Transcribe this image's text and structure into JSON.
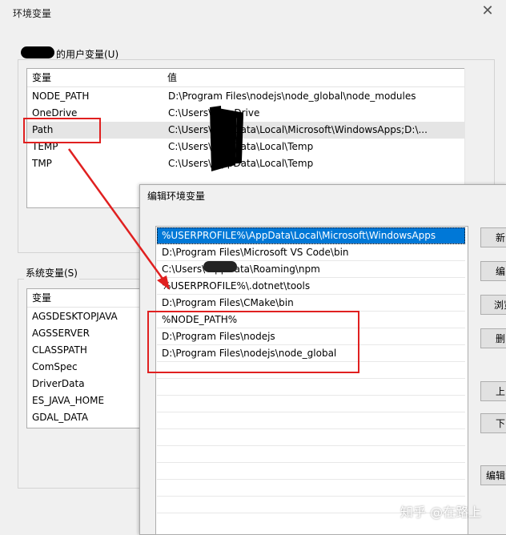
{
  "window": {
    "title": "环境变量",
    "close_glyph": "✕"
  },
  "user_vars": {
    "legend": "的用户变量(U)",
    "headers": [
      "变量",
      "值"
    ],
    "rows": [
      {
        "name": "NODE_PATH",
        "value": "D:\\Program Files\\nodejs\\node_global\\node_modules"
      },
      {
        "name": "OneDrive",
        "value": "C:\\Users\\          OneDrive"
      },
      {
        "name": "Path",
        "value": "C:\\Users\\          AppData\\Local\\Microsoft\\WindowsApps;D:\\..."
      },
      {
        "name": "TEMP",
        "value": "C:\\Users\\          AppData\\Local\\Temp"
      },
      {
        "name": "TMP",
        "value": "C:\\Users\\          AppData\\Local\\Temp"
      }
    ]
  },
  "system_vars": {
    "legend": "系统变量(S)",
    "header": "变量",
    "rows": [
      "AGSDESKTOPJAVA",
      "AGSSERVER",
      "CLASSPATH",
      "ComSpec",
      "DriverData",
      "ES_JAVA_HOME",
      "GDAL_DATA"
    ]
  },
  "edit_dialog": {
    "title": "编辑环境变量",
    "entries": [
      "%USERPROFILE%\\AppData\\Local\\Microsoft\\WindowsApps",
      "D:\\Program Files\\Microsoft VS Code\\bin",
      "C:\\Users\\          AppData\\Roaming\\npm",
      "%USERPROFILE%\\.dotnet\\tools",
      "D:\\Program Files\\CMake\\bin",
      "%NODE_PATH%",
      "D:\\Program Files\\nodejs",
      "D:\\Program Files\\nodejs\\node_global"
    ],
    "selected_index": 0,
    "buttons": [
      "新",
      "编",
      "浏览",
      "删",
      "上",
      "下",
      "编辑"
    ]
  },
  "watermark": "知乎 @在路上",
  "colors": {
    "selection": "#0078d7",
    "highlight_box": "#e02020",
    "arrow": "#e02020"
  }
}
